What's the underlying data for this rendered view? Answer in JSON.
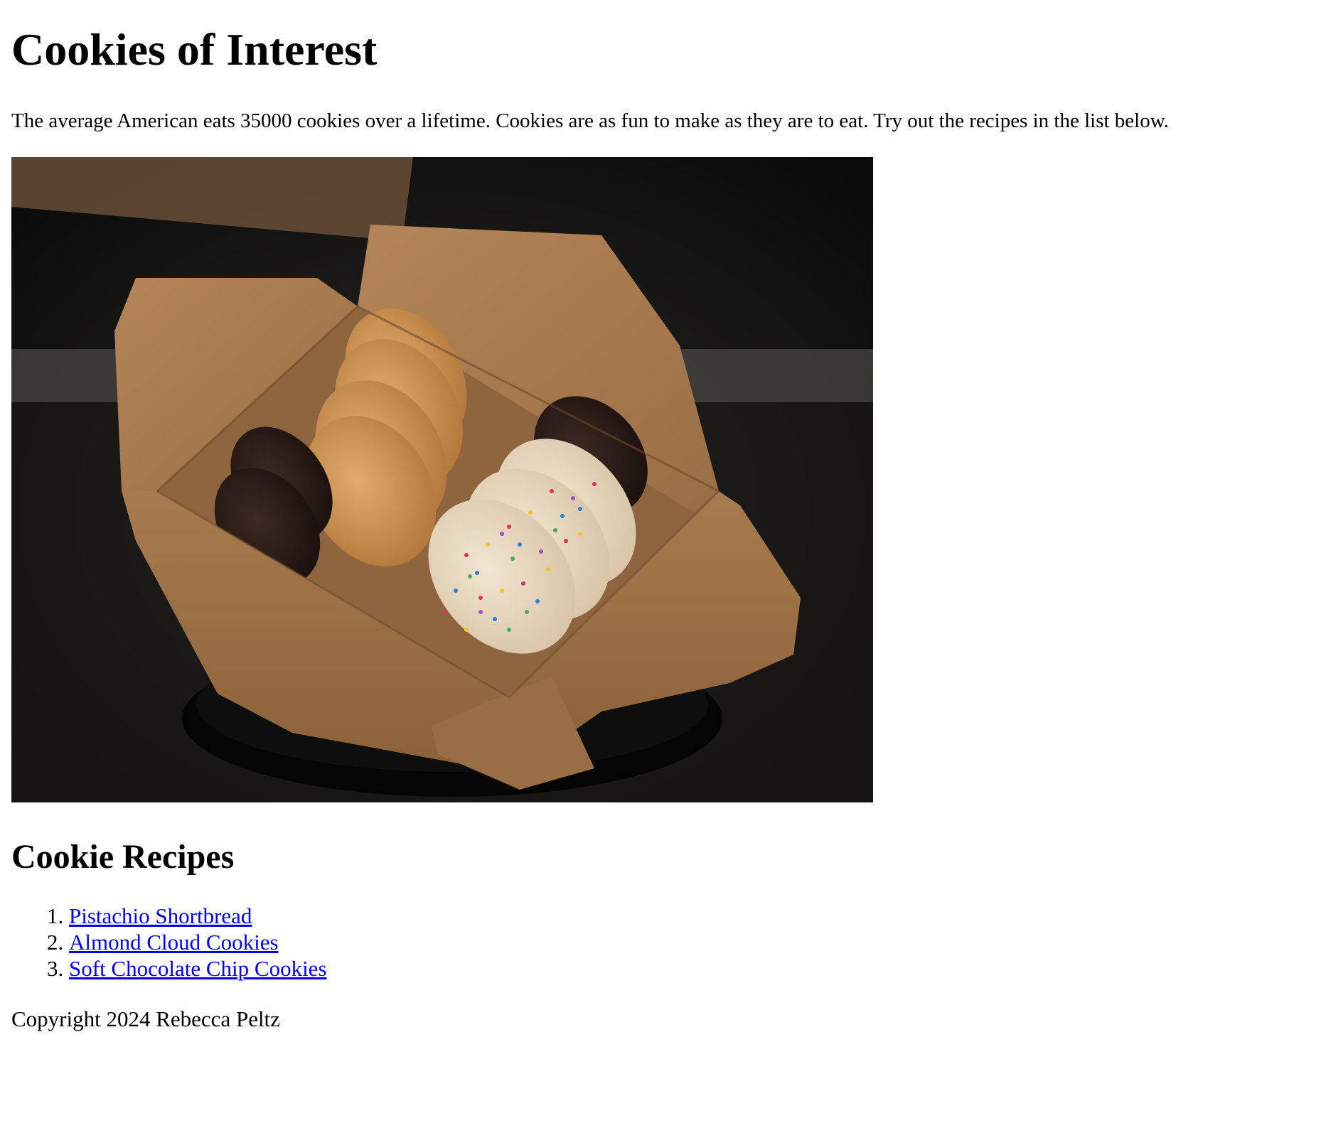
{
  "page": {
    "title": "Cookies of Interest",
    "intro": "The average American eats 35000 cookies over a lifetime. Cookies are as fun to make as they are to eat. Try out the recipes in the list below."
  },
  "photo": {
    "alt": "Takeout box of assorted cookies"
  },
  "recipes": {
    "heading": "Cookie Recipes",
    "items": [
      {
        "label": "Pistachio Shortbread"
      },
      {
        "label": "Almond Cloud Cookies"
      },
      {
        "label": "Soft Chocolate Chip Cookies"
      }
    ]
  },
  "footer": {
    "copyright": "Copyright 2024 Rebecca Peltz"
  },
  "colors": {
    "link": "#0000ee",
    "text": "#000000",
    "background": "#ffffff"
  }
}
